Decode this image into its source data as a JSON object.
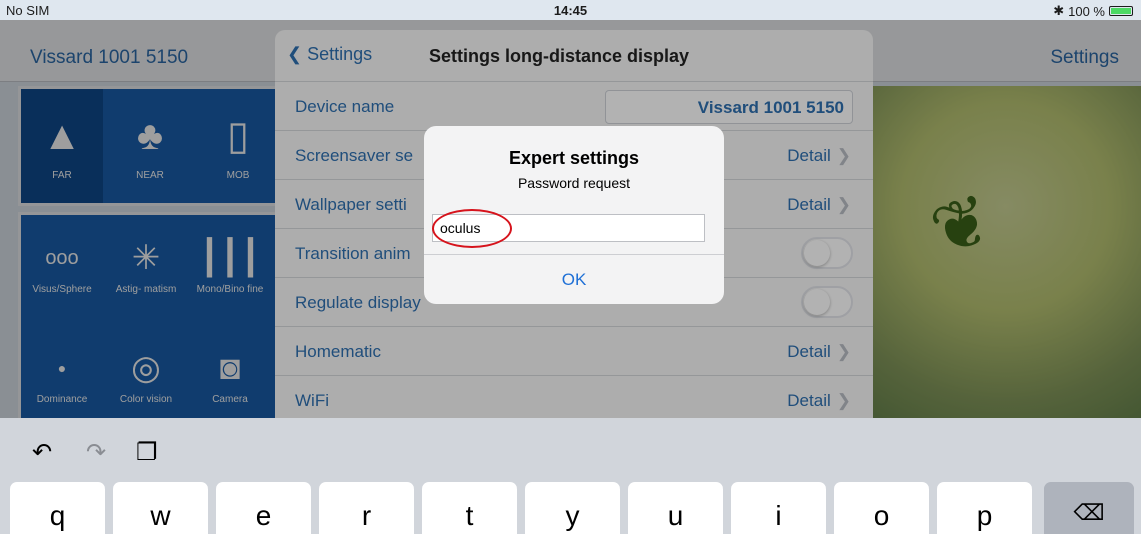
{
  "status": {
    "carrier": "No SIM",
    "time": "14:45",
    "bluetooth": "✱",
    "battery": "100 %"
  },
  "app": {
    "title": "Vissard 1001 5150",
    "settings_link": "Settings",
    "modes": [
      {
        "label": "FAR",
        "icon": "mountain-icon"
      },
      {
        "label": "NEAR",
        "icon": "tulip-icon"
      },
      {
        "label": "MOB",
        "icon": "tablet-icon"
      }
    ],
    "tests": [
      {
        "label": "Visus/Sphere",
        "icon": "letters-icon"
      },
      {
        "label": "Astig-\nmatism",
        "icon": "radial-icon"
      },
      {
        "label": "Mono/Bino\nfine",
        "icon": "lines-icon"
      },
      {
        "label": "Dominance",
        "icon": "dot-icon"
      },
      {
        "label": "Color vision",
        "icon": "color-plate-icon"
      },
      {
        "label": "Camera",
        "icon": "camera-icon"
      }
    ]
  },
  "settings": {
    "back": "Settings",
    "title": "Settings long-distance display",
    "rows": [
      {
        "label": "Device name",
        "value": "Vissard 1001 5150",
        "type": "field"
      },
      {
        "label": "Screensaver se",
        "value": "Detail",
        "type": "detail"
      },
      {
        "label": "Wallpaper setti",
        "value": "Detail",
        "type": "detail"
      },
      {
        "label": "Transition anim",
        "value": "",
        "type": "toggle"
      },
      {
        "label": "Regulate display",
        "value": "",
        "type": "toggle"
      },
      {
        "label": "Homematic",
        "value": "Detail",
        "type": "detail"
      },
      {
        "label": "WiFi",
        "value": "Detail",
        "type": "detail"
      }
    ]
  },
  "alert": {
    "title": "Expert settings",
    "message": "Password request",
    "input_value": "oculus",
    "ok": "OK"
  },
  "keyboard": {
    "keys": [
      "q",
      "w",
      "e",
      "r",
      "t",
      "y",
      "u",
      "i",
      "o",
      "p"
    ],
    "delete": "⌫"
  },
  "colors": {
    "accent": "#2e6fb0",
    "panel": "#1a62b2",
    "annotation": "#d6131c"
  }
}
